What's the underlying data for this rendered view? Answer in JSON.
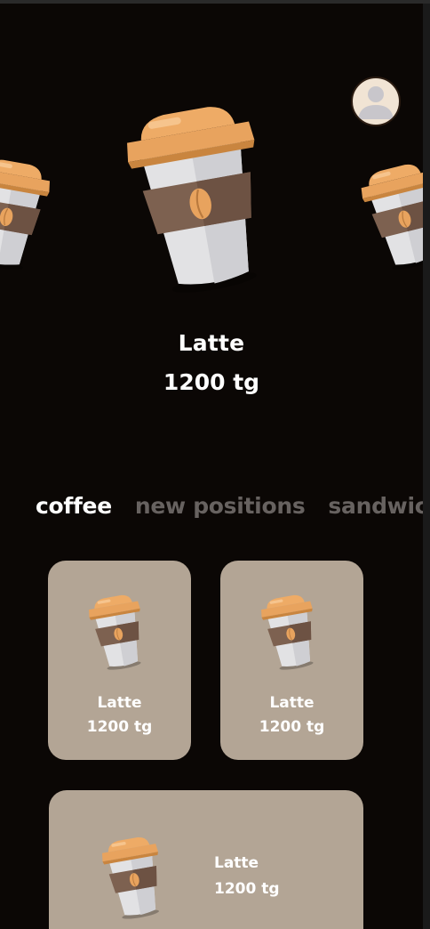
{
  "hero": {
    "product_name": "Latte",
    "product_price": "1200 tg"
  },
  "categories": [
    {
      "label": "coffee",
      "active": true
    },
    {
      "label": "new positions",
      "active": false
    },
    {
      "label": "sandwiches",
      "active": false
    }
  ],
  "products": [
    {
      "name": "Latte",
      "price": "1200 tg"
    },
    {
      "name": "Latte",
      "price": "1200 tg"
    },
    {
      "name": "Latte",
      "price": "1200 tg"
    }
  ],
  "colors": {
    "background": "#0b0705",
    "card": "#b3a595",
    "cup_lid": "#e8a35e",
    "cup_sleeve": "#7d6150",
    "cup_body": "#e2e2e4",
    "active_tab": "#ffffff",
    "inactive_tab": "#676260"
  },
  "icons": {
    "profile": "user-avatar-icon",
    "product": "coffee-cup-icon"
  }
}
